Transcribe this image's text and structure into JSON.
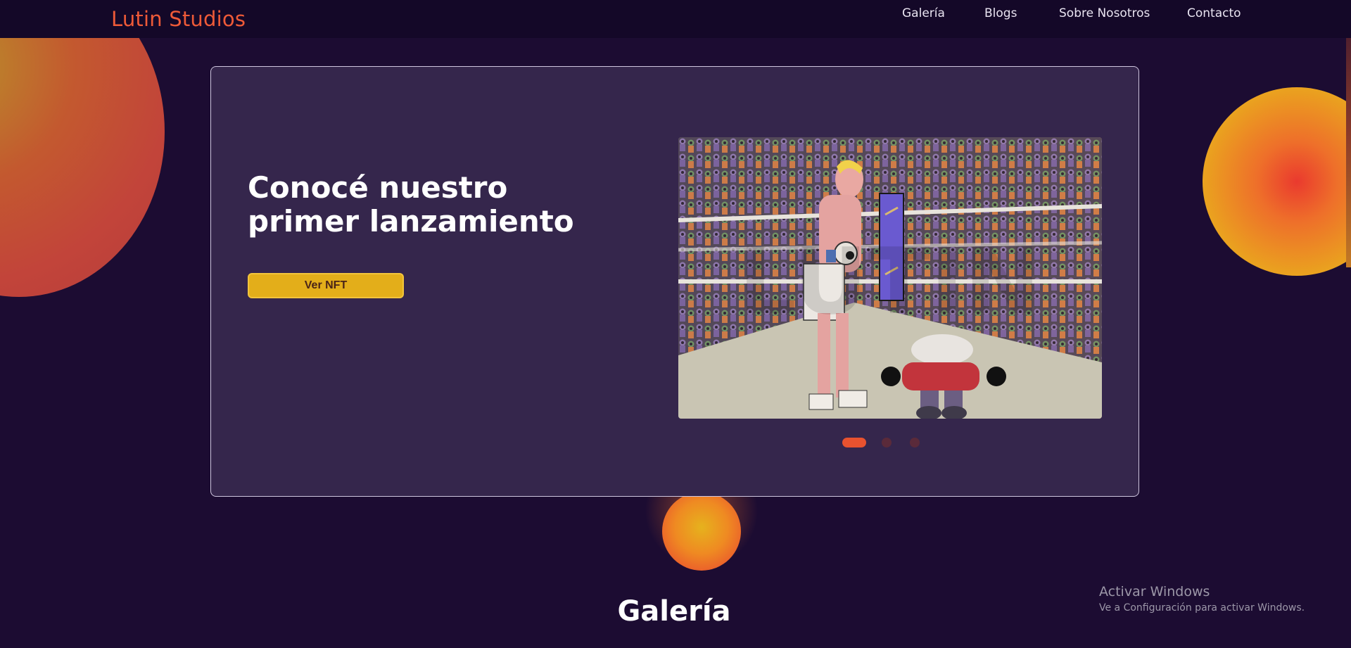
{
  "navbar": {
    "logo": "Lutin Studios",
    "links": [
      "Galería",
      "Blogs",
      "Sobre Nosotros",
      "Contacto"
    ]
  },
  "hero": {
    "title": "Conocé nuestro primer lanzamiento",
    "cta_label": "Ver NFT",
    "slide_image_alt": "boxing-ring-nft-illustration",
    "carousel": {
      "slide_count": 3,
      "active_index": 0
    }
  },
  "gallery": {
    "title": "Galería"
  },
  "windows_watermark": {
    "title": "Activar Windows",
    "subtitle": "Ve a Configuración para activar Windows."
  },
  "colors": {
    "background": "#1c0c32",
    "navbar": "#140828",
    "card": "#35264c",
    "logo": "#ee5a38",
    "button": "#e3ae1a",
    "dot_active": "#e8522f"
  }
}
